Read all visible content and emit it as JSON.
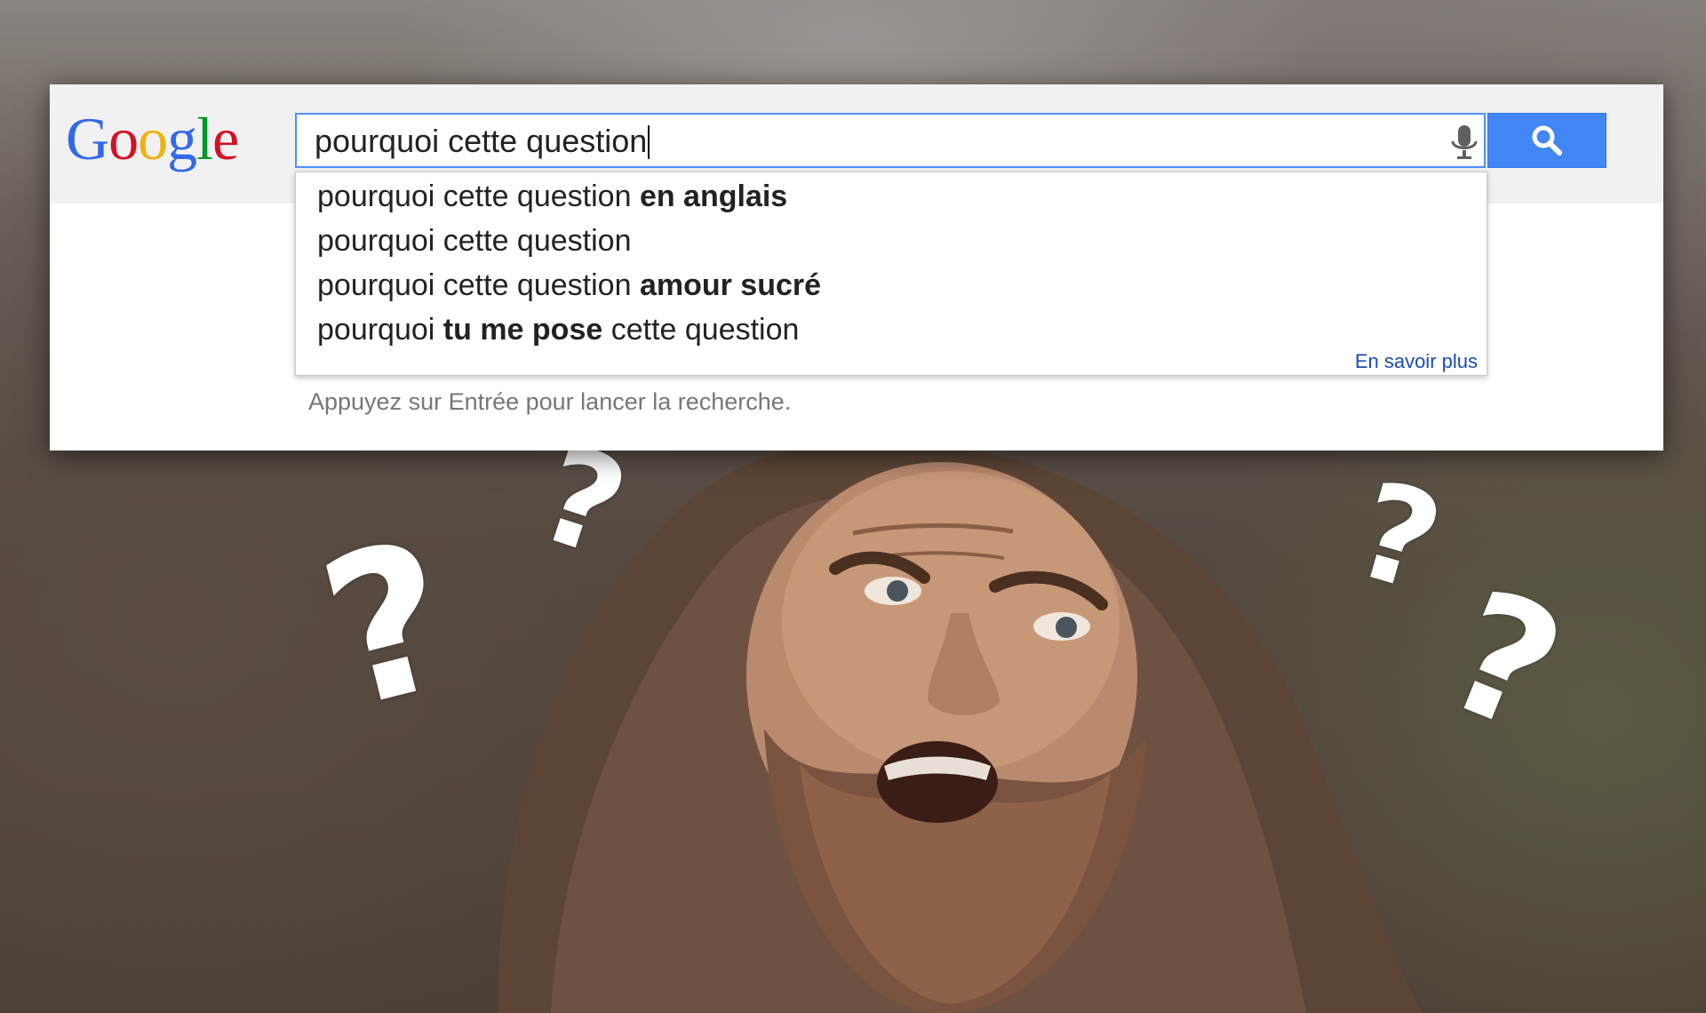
{
  "search": {
    "logo_letters": [
      {
        "char": "G",
        "color": "#3369e8"
      },
      {
        "char": "o",
        "color": "#d50f25"
      },
      {
        "char": "o",
        "color": "#eeb211"
      },
      {
        "char": "g",
        "color": "#3369e8"
      },
      {
        "char": "l",
        "color": "#009925"
      },
      {
        "char": "e",
        "color": "#d50f25"
      }
    ],
    "query": "pourquoi cette question",
    "mic_icon": "microphone-icon",
    "search_icon": "magnifier-icon",
    "accent_color": "#4285f4"
  },
  "suggestions": [
    {
      "parts": [
        {
          "text": "pourquoi cette question ",
          "bold": false
        },
        {
          "text": "en anglais",
          "bold": true
        }
      ]
    },
    {
      "parts": [
        {
          "text": "pourquoi cette question",
          "bold": false
        }
      ]
    },
    {
      "parts": [
        {
          "text": "pourquoi cette question ",
          "bold": false
        },
        {
          "text": "amour sucré",
          "bold": true
        }
      ]
    },
    {
      "parts": [
        {
          "text": "pourquoi ",
          "bold": false
        },
        {
          "text": "tu me pose",
          "bold": true
        },
        {
          "text": " cette question",
          "bold": false
        }
      ]
    }
  ],
  "learn_more": "En savoir plus",
  "hint": "Appuyez sur Entrée pour lancer la recherche.",
  "decor": {
    "question_marks": [
      "?",
      "?",
      "?",
      "?"
    ],
    "photo": "bearded-man-confused"
  }
}
